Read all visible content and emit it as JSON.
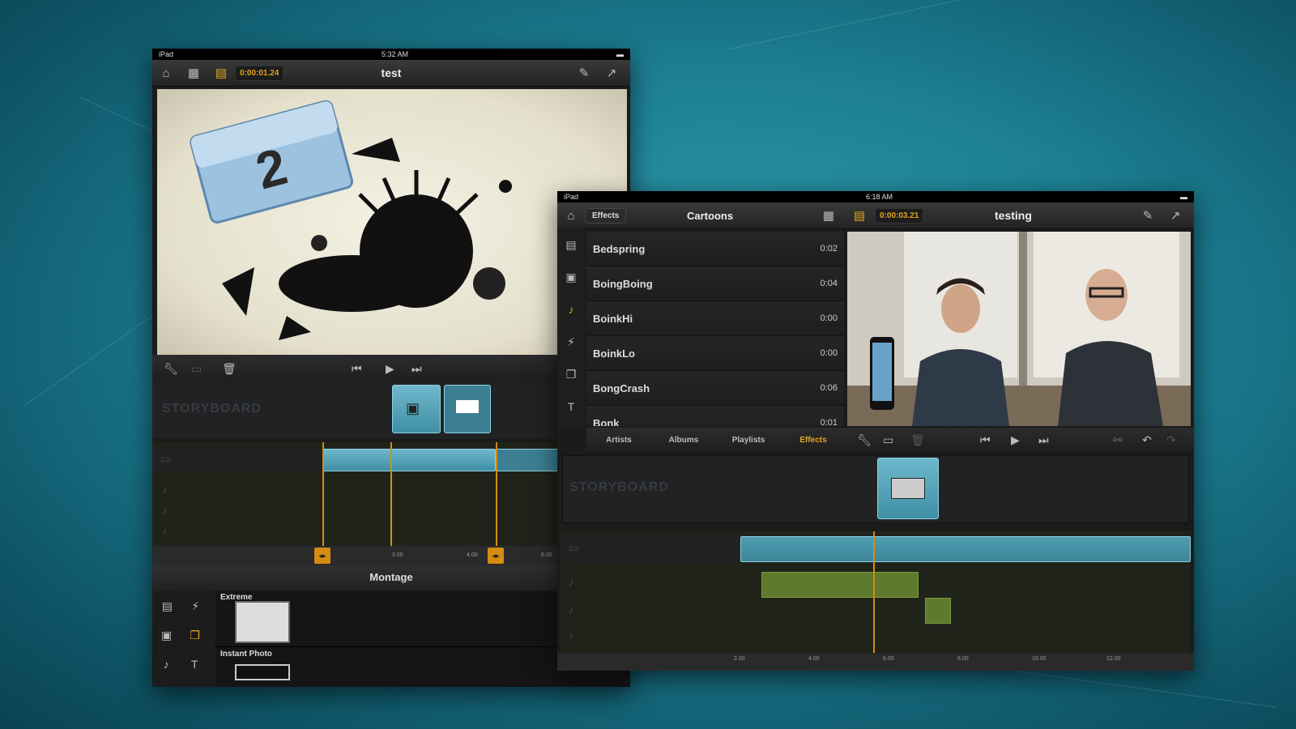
{
  "left_ipad": {
    "status": {
      "device": "iPad",
      "time": "5:32 AM"
    },
    "toolbar": {
      "home_icon": "home-icon",
      "timecode": "0:00:01.24",
      "title": "test",
      "settings_icon": "edit-icon",
      "share_icon": "share-icon"
    },
    "storyboard_label": "STORYBOARD",
    "ruler_ticks": [
      "3.00",
      "4.00",
      "6.00"
    ],
    "montage": {
      "title": "Montage",
      "items": [
        {
          "label": "Extreme"
        },
        {
          "label": "Instant Photo"
        }
      ]
    }
  },
  "right_ipad": {
    "status": {
      "device": "iPad",
      "time": "6:18 AM"
    },
    "toolbar": {
      "home_icon": "home-icon",
      "effects_button": "Effects",
      "browser_title": "Cartoons",
      "timecode": "0:00:03.21",
      "title": "testing"
    },
    "effects_list": [
      {
        "name": "Bedspring",
        "duration": "0:02"
      },
      {
        "name": "BoingBoing",
        "duration": "0:04"
      },
      {
        "name": "BoinkHi",
        "duration": "0:00"
      },
      {
        "name": "BoinkLo",
        "duration": "0:00"
      },
      {
        "name": "BongCrash",
        "duration": "0:06"
      },
      {
        "name": "Bonk",
        "duration": "0:01"
      }
    ],
    "tabs": [
      {
        "label": "Artists",
        "active": false
      },
      {
        "label": "Albums",
        "active": false
      },
      {
        "label": "Playlists",
        "active": false
      },
      {
        "label": "Effects",
        "active": true
      }
    ],
    "storyboard_label": "STORYBOARD",
    "ruler_ticks": [
      "2.00",
      "4.00",
      "6.00",
      "8.00",
      "10.00",
      "12.00"
    ]
  },
  "colors": {
    "accent": "#e2a51f",
    "clip": "#4a9db3",
    "background": "#1d7f93"
  }
}
